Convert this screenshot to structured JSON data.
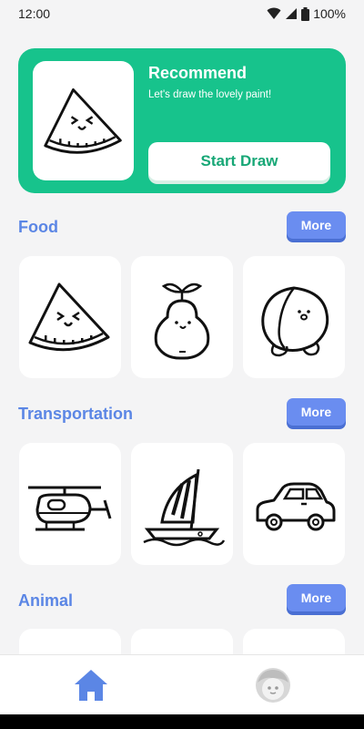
{
  "status": {
    "time": "12:00",
    "battery": "100%"
  },
  "hero": {
    "title": "Recommend",
    "subtitle": "Let's draw the lovely paint!",
    "button_label": "Start Draw",
    "thumb_icon": "watermelon-icon"
  },
  "sections": [
    {
      "title": "Food",
      "more_label": "More",
      "cards": [
        "watermelon-icon",
        "pear-icon",
        "peach-icon"
      ]
    },
    {
      "title": "Transportation",
      "more_label": "More",
      "cards": [
        "helicopter-icon",
        "sailboat-icon",
        "car-icon"
      ]
    },
    {
      "title": "Animal",
      "more_label": "More",
      "cards": []
    }
  ],
  "nav": {
    "home_icon": "home-icon",
    "profile_icon": "profile-face-icon"
  },
  "colors": {
    "accent_green": "#17c38c",
    "accent_blue": "#5b86e5",
    "button_blue": "#6a8df0"
  }
}
